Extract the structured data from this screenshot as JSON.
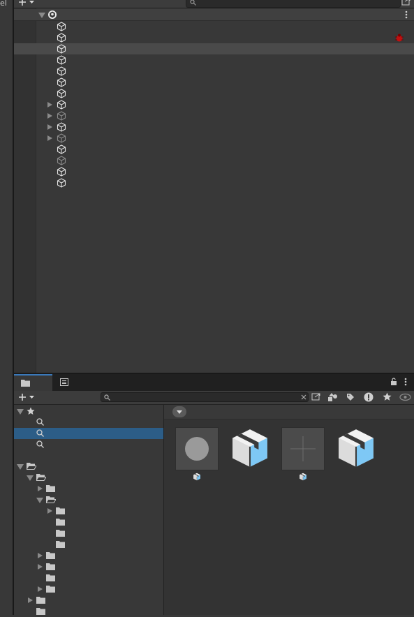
{
  "left_panel": {
    "tab_fragment": "el"
  },
  "hierarchy": {
    "toolbar": {
      "add_icon": "plus-icon",
      "search_placeholder": ""
    },
    "scene": {
      "name": "",
      "icon": "unity-scene-icon",
      "menu_icon": "kebab-menu-icon"
    },
    "rows": [
      {
        "label": "",
        "foldout": false,
        "dim": false,
        "selected": false,
        "warning": false
      },
      {
        "label": "",
        "foldout": false,
        "dim": false,
        "selected": false,
        "warning": true
      },
      {
        "label": "",
        "foldout": false,
        "dim": false,
        "selected": true,
        "warning": false
      },
      {
        "label": "",
        "foldout": false,
        "dim": false,
        "selected": false,
        "warning": false
      },
      {
        "label": "",
        "foldout": false,
        "dim": false,
        "selected": false,
        "warning": false
      },
      {
        "label": "",
        "foldout": false,
        "dim": false,
        "selected": false,
        "warning": false
      },
      {
        "label": "",
        "foldout": false,
        "dim": false,
        "selected": false,
        "warning": false
      },
      {
        "label": "",
        "foldout": true,
        "dim": false,
        "selected": false,
        "warning": false
      },
      {
        "label": "",
        "foldout": true,
        "dim": true,
        "selected": false,
        "warning": false
      },
      {
        "label": "",
        "foldout": true,
        "dim": false,
        "selected": false,
        "warning": false
      },
      {
        "label": "",
        "foldout": true,
        "dim": true,
        "selected": false,
        "warning": false
      },
      {
        "label": "",
        "foldout": false,
        "dim": false,
        "selected": false,
        "warning": false
      },
      {
        "label": "",
        "foldout": false,
        "dim": true,
        "selected": false,
        "warning": false
      },
      {
        "label": "",
        "foldout": false,
        "dim": false,
        "selected": false,
        "warning": false
      },
      {
        "label": "",
        "foldout": false,
        "dim": false,
        "selected": false,
        "warning": false
      }
    ]
  },
  "project": {
    "tabs": [
      {
        "name": "project",
        "icon": "folder-icon",
        "active": true
      },
      {
        "name": "console",
        "icon": "console-icon",
        "active": false
      }
    ],
    "search_placeholder": "",
    "toolbar_icons": [
      "search-by-type-icon",
      "search-by-label-icon",
      "error-filter-icon",
      "favorites-icon",
      "hidden-packages-icon"
    ],
    "favorites": {
      "label": "",
      "items": [
        "",
        "",
        ""
      ],
      "selected_index": 1
    },
    "assets_tree": {
      "root_label": ""
    },
    "grid_items": [
      {
        "name": "",
        "kind": "material"
      },
      {
        "name": "",
        "kind": "prefab"
      },
      {
        "name": "",
        "kind": "empty"
      },
      {
        "name": "",
        "kind": "prefab"
      }
    ],
    "colors": {
      "selection": "#2c5d87",
      "active_tab_accent": "#3a79bb",
      "prefab_blue": "#7ec8f5"
    }
  }
}
